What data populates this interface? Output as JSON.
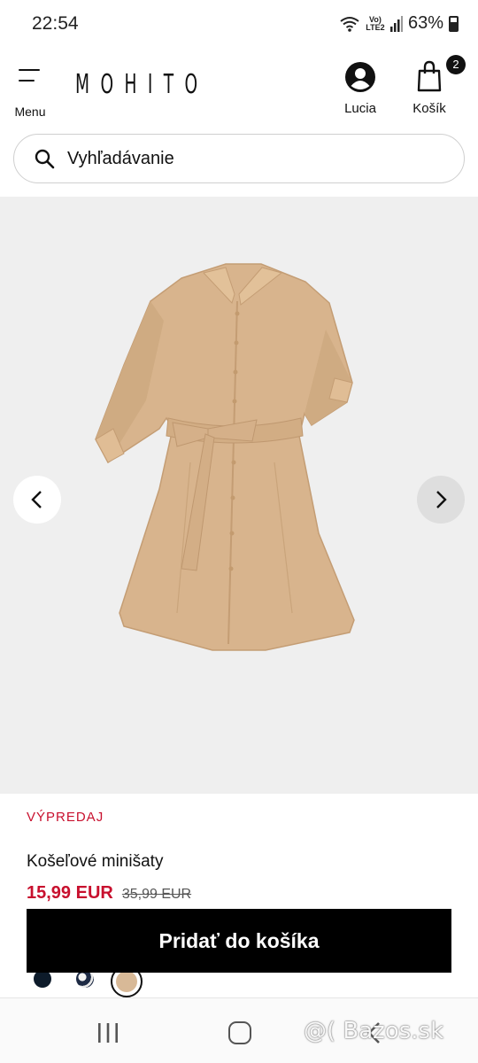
{
  "status_bar": {
    "time": "22:54",
    "network_label": "Vo) LTE2",
    "battery": "63%"
  },
  "header": {
    "menu_label": "Menu",
    "logo": "MOHITO",
    "user_label": "Lucia",
    "cart_label": "Košík",
    "cart_count": "2"
  },
  "search": {
    "placeholder": "Vyhľadávanie"
  },
  "gallery": {
    "image_icon": "beige-shirt-dress-image",
    "prev_icon": "chevron-left-icon",
    "next_icon": "chevron-right-icon"
  },
  "product": {
    "badge": "VÝPREDAJ",
    "name": "Košeľové minišaty",
    "price_current": "15,99 EUR",
    "price_old": "35,99 EUR",
    "add_to_cart_label": "Pridať do košíka",
    "color_swatches": [
      {
        "name": "navy",
        "color": "#0d1b2a"
      },
      {
        "name": "navy-white-pattern",
        "color": "#1d2a44"
      },
      {
        "name": "beige",
        "color": "#d8b997",
        "selected": true
      }
    ]
  },
  "colors": {
    "sale_red": "#c8102e",
    "button_black": "#000000",
    "image_bg": "#efefef"
  },
  "watermark": "@( Bazos.sk"
}
